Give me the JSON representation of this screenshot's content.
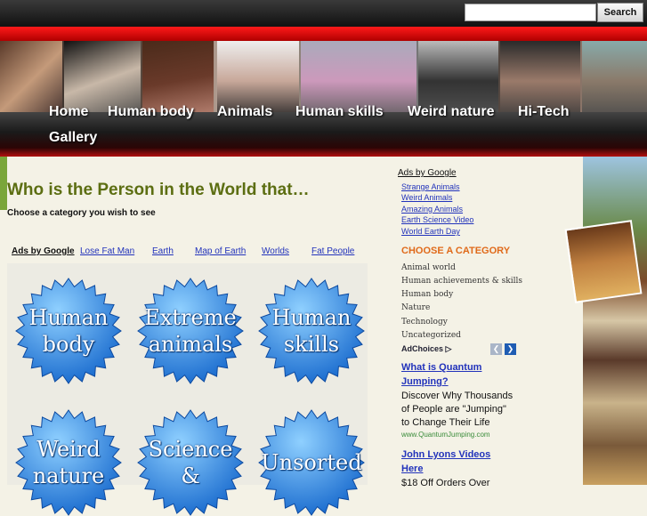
{
  "search": {
    "placeholder": "",
    "button_label": "Search"
  },
  "nav": [
    "Home",
    "Human body",
    "Animals",
    "Human skills",
    "Weird nature",
    "Hi-Tech",
    "Gallery"
  ],
  "main": {
    "title": "Who is the Person in the World that…",
    "subtitle": "Choose a category you wish to see",
    "ads_label": "Ads by Google",
    "ads_links": [
      "Lose Fat Man",
      "Earth",
      "Map of Earth",
      "Worlds",
      "Fat People"
    ],
    "categories": [
      {
        "line1": "Human",
        "line2": "body"
      },
      {
        "line1": "Extreme",
        "line2": "animals"
      },
      {
        "line1": "Human",
        "line2": "skills"
      },
      {
        "line1": "Weird",
        "line2": "nature"
      },
      {
        "line1": "Science",
        "line2": "&"
      },
      {
        "line1": "Unsorted",
        "line2": ""
      }
    ],
    "badge_color": "#1e6fd0"
  },
  "sidebar": {
    "ads_label": "Ads by Google",
    "ads_links": [
      "Strange Animals",
      "Weird Animals",
      "Amazing Animals",
      "Earth Science Video",
      "World Earth Day"
    ],
    "category_title": "CHOOSE A CATEGORY",
    "category_items": [
      "Animal world",
      "Human achievements & skills",
      "Human body",
      "Nature",
      "Technology",
      "Uncategorized"
    ],
    "adchoices": "AdChoices",
    "ad1": {
      "headline_1": "What is Quantum",
      "headline_2": "Jumping?",
      "body_1": "Discover Why Thousands",
      "body_2": "of People are \"Jumping\"",
      "body_3": "to Change Their Life",
      "url": "www.QuantumJumping.com"
    },
    "ad2": {
      "headline_1": "John Lyons Videos",
      "headline_2": "Here",
      "body_1": "$18 Off Orders Over"
    }
  },
  "colors": {
    "accent_red": "#e00000",
    "title_green": "#5c6e12",
    "category_orange": "#e06a1a",
    "link_blue": "#2233bb"
  }
}
